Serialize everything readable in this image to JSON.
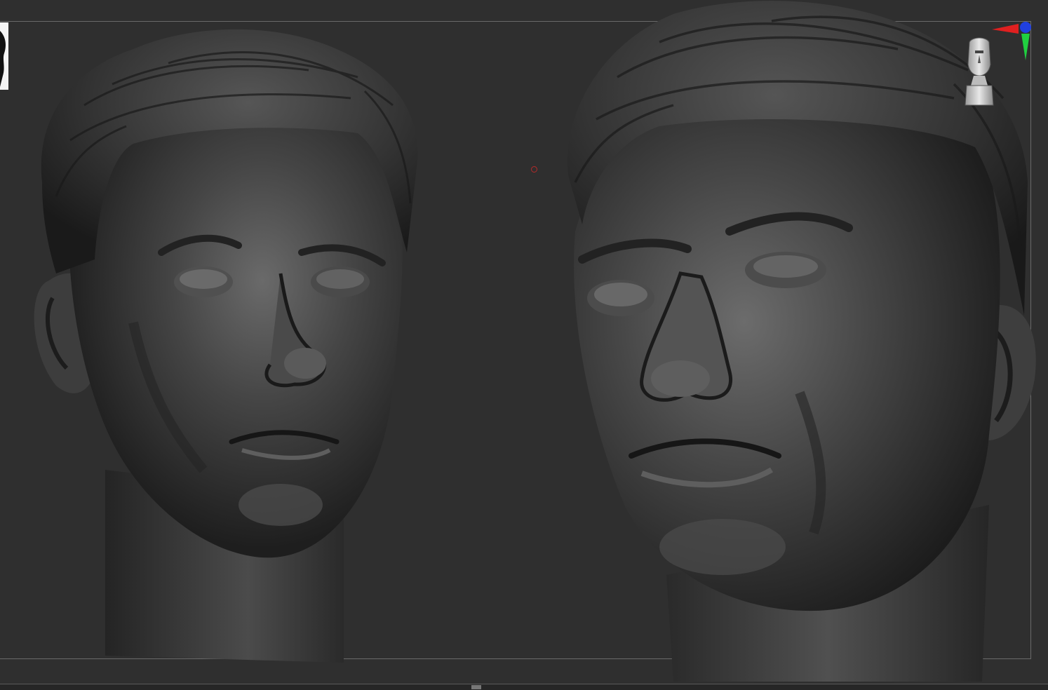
{
  "viewport": {
    "background": "#2f2f2f",
    "frame_color": "#6a6a6a"
  },
  "model": {
    "material_base": "#3a3a3a",
    "material_highlight": "#6e6e6e",
    "material_shadow": "#151515"
  },
  "gizmo": {
    "x_axis_color": "#e02020",
    "y_axis_color": "#20d040",
    "z_axis_color": "#2040e0",
    "icon": "head-orientation-icon"
  },
  "pivot": {
    "color": "#b42a2a"
  }
}
